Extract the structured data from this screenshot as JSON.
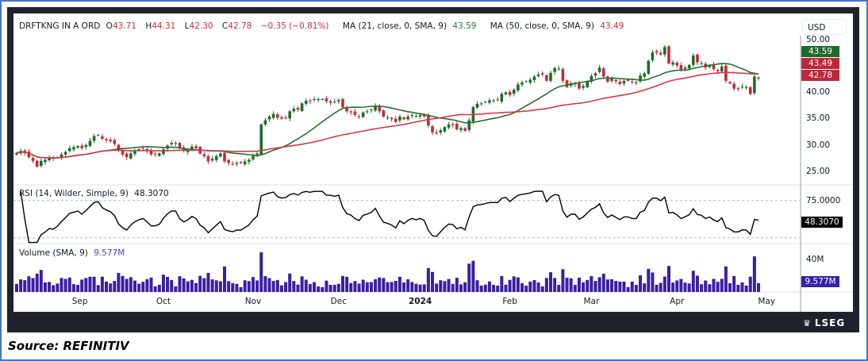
{
  "header": {
    "symbol": "DRFTKNG IN A ORD",
    "open_label": "O",
    "open": "43.71",
    "high_label": "H",
    "high": "44.31",
    "low_label": "L",
    "low": "42.30",
    "close_label": "C",
    "close": "42.78",
    "change": "−0.35 (−0.81%)",
    "ma1_label": "MA (21, close, 0, SMA, 9)",
    "ma1_value": "43.59",
    "ma2_label": "MA (50, close, 0, SMA, 9)",
    "ma2_value": "43.49"
  },
  "price_axis": {
    "currency": "USD",
    "ticks": [
      "50.00",
      "40.00",
      "35.00",
      "30.00",
      "25.00"
    ],
    "tags": {
      "ma21": "43.59",
      "ma50": "43.49",
      "last": "42.78"
    }
  },
  "rsi": {
    "label": "RSI (14, Wilder, Simple, 9)",
    "value": "48.3070",
    "tick": "75.0000"
  },
  "volume": {
    "label": "Volume (SMA, 9)",
    "value": "9.577M",
    "tick": "40M"
  },
  "footer": {
    "brand": "LSEG",
    "source": "Source: REFINITIV"
  },
  "colors": {
    "up": "#1f6b2a",
    "down": "#c4283a",
    "ma21": "#2a6e2f",
    "ma50": "#d03a48",
    "volume": "#3a1fa3",
    "rsi": "#000000"
  },
  "chart_data": {
    "type": "candlestick",
    "title": "DRFTKNG IN A ORD",
    "ylabel": "USD",
    "ylim": [
      23,
      51
    ],
    "time_ticks": [
      {
        "label": "Sep",
        "bar": 15.5
      },
      {
        "label": "Oct",
        "bar": 36
      },
      {
        "label": "Nov",
        "bar": 58
      },
      {
        "label": "Dec",
        "bar": 79
      },
      {
        "label": "2024",
        "bar": 99,
        "bold": true
      },
      {
        "label": "Feb",
        "bar": 121
      },
      {
        "label": "Mar",
        "bar": 141
      },
      {
        "label": "Apr",
        "bar": 162
      },
      {
        "label": "May",
        "bar": 184
      }
    ],
    "closes": [
      28.5,
      28.9,
      28.5,
      27.7,
      27.0,
      25.9,
      27.0,
      27.2,
      27.5,
      27.4,
      27.7,
      28.2,
      28.7,
      29.4,
      29.6,
      29.8,
      29.4,
      30.0,
      30.8,
      31.7,
      31.9,
      31.2,
      30.9,
      30.7,
      30.2,
      28.9,
      28.2,
      27.7,
      28.4,
      28.9,
      29.2,
      29.4,
      28.9,
      28.2,
      28.2,
      28.4,
      29.2,
      29.9,
      30.4,
      30.4,
      29.4,
      28.9,
      29.2,
      29.7,
      29.4,
      28.4,
      27.9,
      26.9,
      27.4,
      27.9,
      28.4,
      26.9,
      26.6,
      26.4,
      26.6,
      26.6,
      26.9,
      27.2,
      27.9,
      28.4,
      33.9,
      34.7,
      35.4,
      35.9,
      35.2,
      35.0,
      35.2,
      36.4,
      36.9,
      36.7,
      37.9,
      38.4,
      38.3,
      38.7,
      38.7,
      38.7,
      38.3,
      38.3,
      38.2,
      38.5,
      37.2,
      36.4,
      36.2,
      35.7,
      35.4,
      36.2,
      36.4,
      36.7,
      37.4,
      36.4,
      35.4,
      35.2,
      34.9,
      34.4,
      35.4,
      34.9,
      35.4,
      35.7,
      35.5,
      35.7,
      35.4,
      33.7,
      32.4,
      32.2,
      32.8,
      33.4,
      33.9,
      33.8,
      33.0,
      33.2,
      32.7,
      34.7,
      37.2,
      37.8,
      37.9,
      38.2,
      38.5,
      38.5,
      38.5,
      39.7,
      40.0,
      39.5,
      40.5,
      41.5,
      41.9,
      42.1,
      42.4,
      43.0,
      43.4,
      43.4,
      42.2,
      43.7,
      44.6,
      44.5,
      42.2,
      41.0,
      41.7,
      41.7,
      40.7,
      41.2,
      42.1,
      43.1,
      43.6,
      44.7,
      43.0,
      42.0,
      42.6,
      42.1,
      41.6,
      42.2,
      42.2,
      41.9,
      41.9,
      43.2,
      43.6,
      46.0,
      47.6,
      47.6,
      47.2,
      48.6,
      45.5,
      45.7,
      45.1,
      44.2,
      44.7,
      45.2,
      47.0,
      45.7,
      45.5,
      44.7,
      45.1,
      44.4,
      44.0,
      44.9,
      42.2,
      41.7,
      40.7,
      40.7,
      41.1,
      41.0,
      39.7,
      43.0,
      42.78
    ],
    "ma_periods": [
      21,
      50
    ],
    "rsi_period": 14,
    "rsi_levels": [
      70,
      30
    ],
    "volume_unit": "M",
    "volume_last_sma9": 9.577
  }
}
